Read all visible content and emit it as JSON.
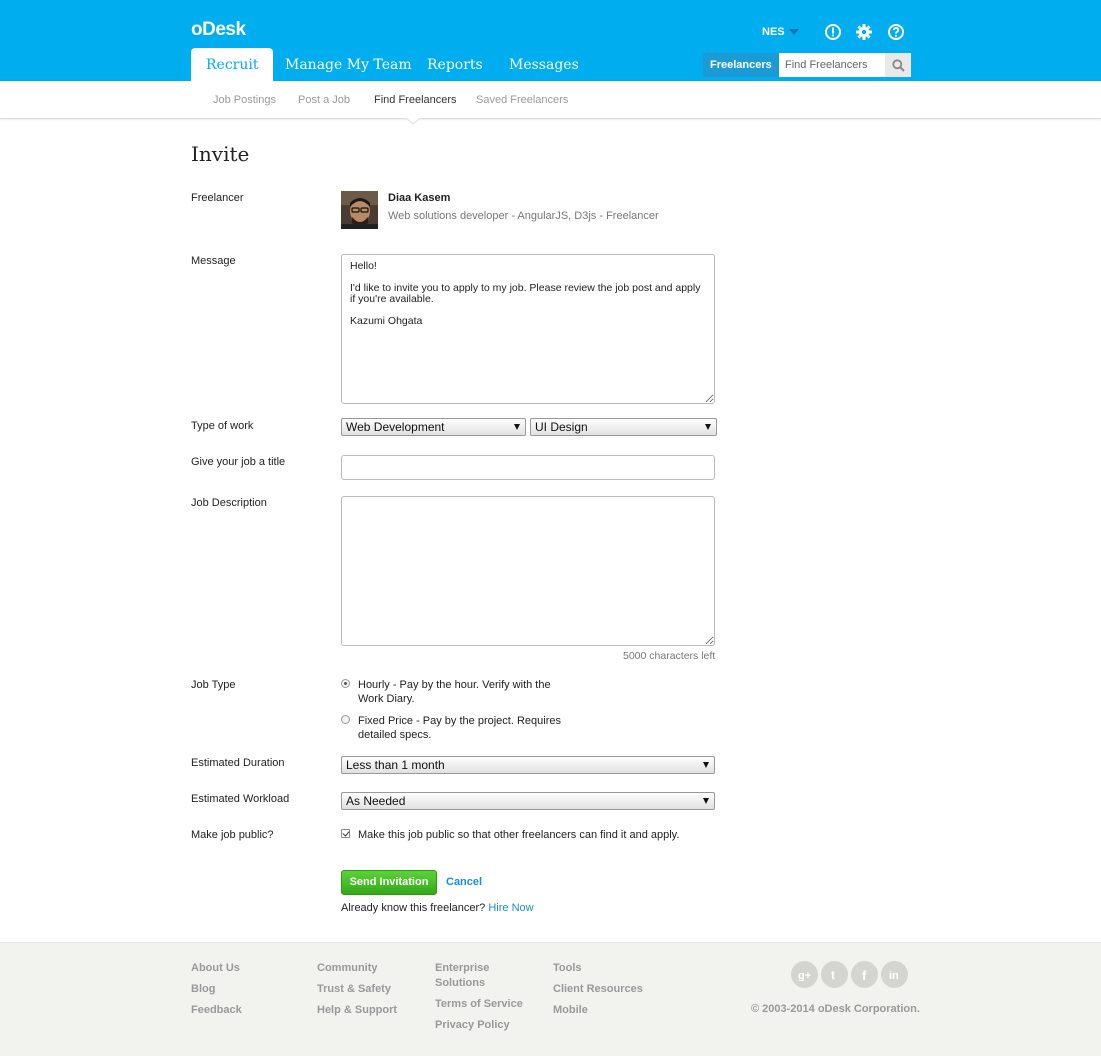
{
  "header": {
    "logo": "oDesk",
    "user": "NES",
    "tabs": [
      {
        "label": "Recruit"
      },
      {
        "label": "Manage My Team"
      },
      {
        "label": "Reports"
      },
      {
        "label": "Messages"
      }
    ],
    "search": {
      "scope": "Freelancers",
      "placeholder": "Find Freelancers"
    },
    "icons": [
      "alert-icon",
      "gear-icon",
      "help-icon",
      "search-icon"
    ]
  },
  "subnav": {
    "items": [
      {
        "label": "Job Postings"
      },
      {
        "label": "Post a Job"
      },
      {
        "label": "Find Freelancers"
      },
      {
        "label": "Saved Freelancers"
      }
    ],
    "active": "Find Freelancers"
  },
  "form": {
    "title": "Invite",
    "freelancer": {
      "label": "Freelancer",
      "name": "Diaa Kasem",
      "headline": "Web solutions developer - AngularJS, D3js - Freelancer"
    },
    "message": {
      "label": "Message",
      "value": "Hello!\n\nI'd like to invite you to apply to my job. Please review the job post and apply if you're available.\n\nKazumi Ohgata"
    },
    "type_of_work": {
      "label": "Type of work",
      "category": "Web Development",
      "subcategory": "UI Design"
    },
    "job_title": {
      "label": "Give your job a title",
      "value": ""
    },
    "job_description": {
      "label": "Job Description",
      "value": "",
      "chars_left": "5000 characters left"
    },
    "job_type": {
      "label": "Job Type",
      "options": [
        {
          "text": "Hourly - Pay by the hour. Verify with the Work Diary.",
          "selected": true
        },
        {
          "text": "Fixed Price - Pay by the project. Requires detailed specs.",
          "selected": false
        }
      ]
    },
    "duration": {
      "label": "Estimated Duration",
      "value": "Less than 1 month"
    },
    "workload": {
      "label": "Estimated Workload",
      "value": "As Needed"
    },
    "public": {
      "label": "Make job public?",
      "text": "Make this job public so that other freelancers can find it and apply.",
      "checked": true
    },
    "send_label": "Send Invitation",
    "cancel_label": "Cancel",
    "already_text": "Already know this freelancer?",
    "hire_now": "Hire Now"
  },
  "footer": {
    "col1": [
      "About Us",
      "Blog",
      "Feedback"
    ],
    "col2": [
      "Community",
      "Trust & Safety",
      "Help & Support"
    ],
    "col3": [
      "Enterprise Solutions",
      "Terms of Service",
      "Privacy Policy"
    ],
    "col4": [
      "Tools",
      "Client Resources",
      "Mobile"
    ],
    "social": [
      "google-plus-icon",
      "twitter-icon",
      "facebook-icon",
      "linkedin-icon"
    ],
    "copyright": "© 2003-2014 oDesk Corporation."
  },
  "colors": {
    "brand": "#00aeef",
    "link": "#1a8fcc",
    "button_green": "#3bb51f"
  }
}
